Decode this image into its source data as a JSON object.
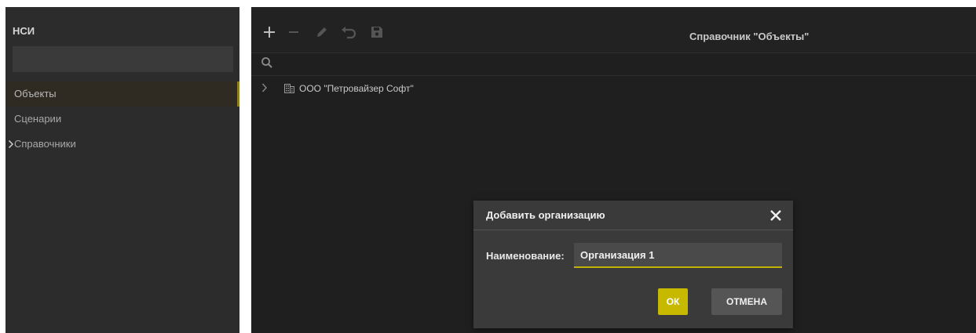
{
  "sidebar": {
    "title": "НСИ",
    "search_value": "",
    "items": [
      {
        "label": "Объекты"
      },
      {
        "label": "Сценарии"
      },
      {
        "label": "Справочники"
      }
    ]
  },
  "toolbar": {
    "title": "Справочник \"Объекты\"",
    "icons": [
      "add-icon",
      "remove-icon",
      "edit-icon",
      "undo-icon",
      "save-icon"
    ]
  },
  "tree": {
    "items": [
      {
        "label": "ООО \"Петровайзер Софт\""
      }
    ]
  },
  "dialog": {
    "title": "Добавить организацию",
    "field_label": "Наименование:",
    "field_value": "Организация 1",
    "ok_label": "ОК",
    "cancel_label": "ОТМЕНА"
  },
  "colors": {
    "accent": "#c7b900",
    "active_marker": "#8e7d1e",
    "panel": "#2c2c2c",
    "main_bg": "#1f1f1f",
    "dialog_bg": "#3a3a3a"
  }
}
